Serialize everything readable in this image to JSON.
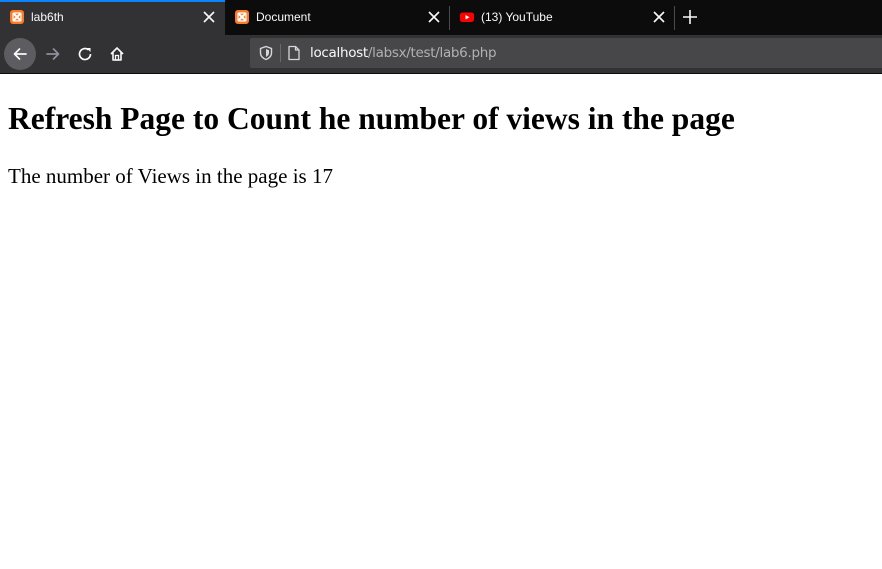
{
  "tabs": [
    {
      "title": "lab6th",
      "favicon": "xampp-icon",
      "active": true
    },
    {
      "title": "Document",
      "favicon": "xampp-icon",
      "active": false
    },
    {
      "title": "(13) YouTube",
      "favicon": "youtube-icon",
      "active": false
    }
  ],
  "url": {
    "host": "localhost",
    "path": "/labsx/test/lab6.php"
  },
  "page": {
    "heading": "Refresh Page to Count he number of views in the page",
    "views_text": "The number of Views in the page is 17"
  },
  "colors": {
    "tabstrip_bg": "#0c0c0d",
    "active_tab_bg": "#323234",
    "accent": "#0a84ff",
    "urlbar_bg": "#474749",
    "xampp_orange": "#fb7a24",
    "youtube_red": "#ff0000"
  }
}
